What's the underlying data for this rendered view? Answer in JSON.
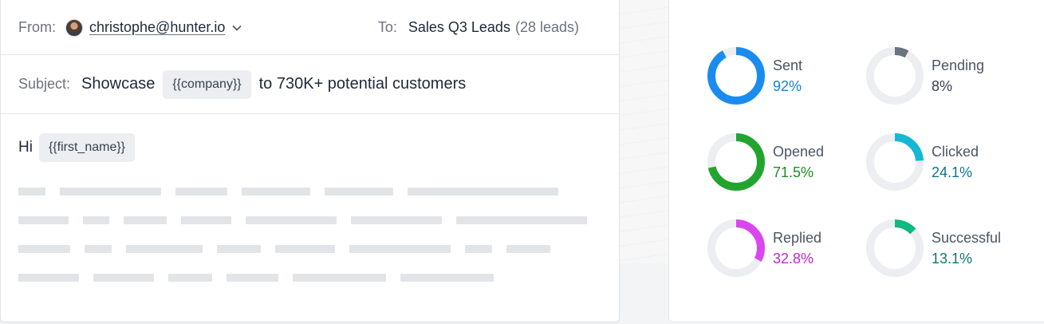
{
  "composer": {
    "from_label": "From:",
    "sender": "christophe@hunter.io",
    "to_label": "To:",
    "to_list": "Sales Q3 Leads",
    "to_count": "(28 leads)",
    "subject_label": "Subject:",
    "subject_before": "Showcase",
    "subject_tag": "{{company}}",
    "subject_after": "to 730K+ potential customers",
    "greeting": "Hi",
    "greeting_tag": "{{first_name}}"
  },
  "icons": {
    "avatar": "sender-avatar",
    "chevron": "chevron-down-icon"
  },
  "stats": [
    {
      "label": "Sent",
      "value": "92%",
      "fraction": 0.92,
      "color": "#1a8cf0"
    },
    {
      "label": "Pending",
      "value": "8%",
      "fraction": 0.08,
      "color": "#6b7280"
    },
    {
      "label": "Opened",
      "value": "71.5%",
      "fraction": 0.715,
      "color": "#22a52e"
    },
    {
      "label": "Clicked",
      "value": "24.1%",
      "fraction": 0.241,
      "color": "#14b8d4"
    },
    {
      "label": "Replied",
      "value": "32.8%",
      "fraction": 0.328,
      "color": "#d946ef"
    },
    {
      "label": "Successful",
      "value": "13.1%",
      "fraction": 0.131,
      "color": "#10b981"
    }
  ],
  "value_colors": {
    "Sent": "#1a7fd8",
    "Pending": "#374151",
    "Opened": "#1a8f22",
    "Clicked": "#0e7490",
    "Replied": "#c026d3",
    "Successful": "#0f766e"
  }
}
